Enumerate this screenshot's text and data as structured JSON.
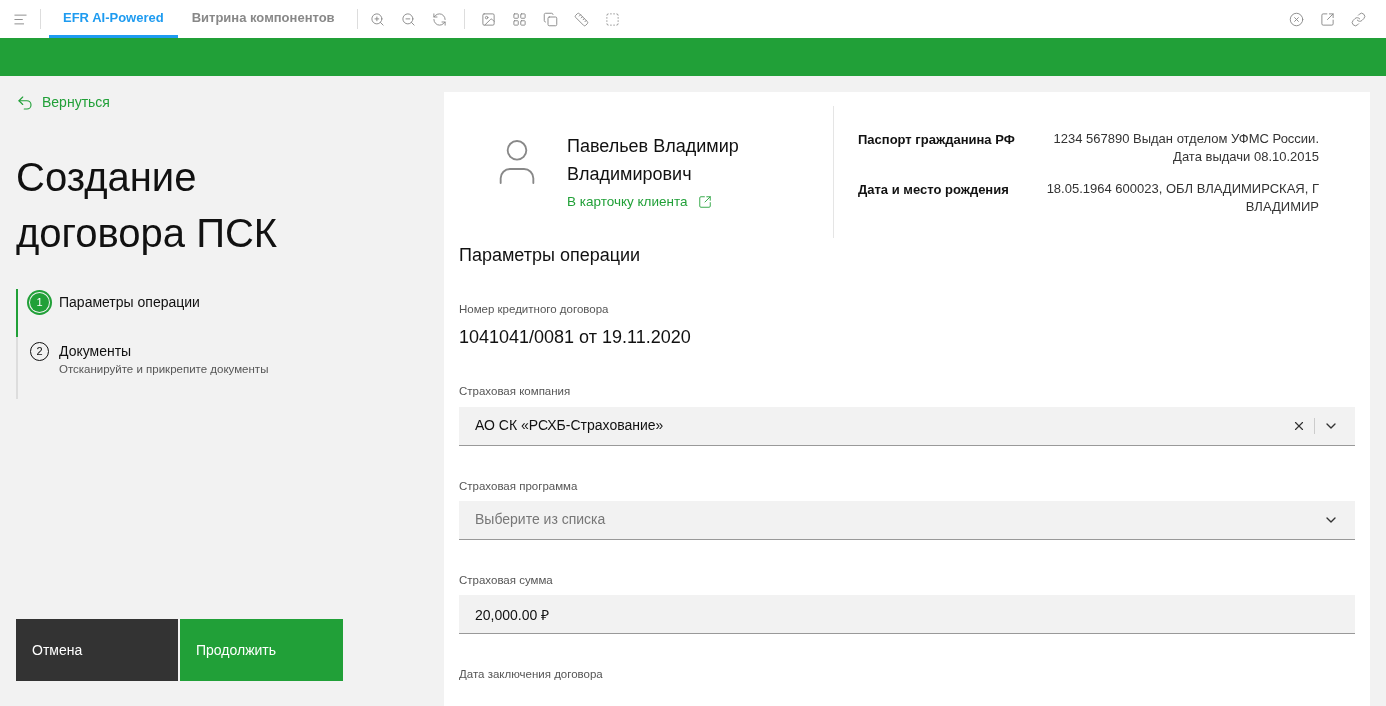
{
  "tabs": [
    {
      "label": "EFR AI-Powered",
      "selected": true
    },
    {
      "label": "Витрина компонентов",
      "selected": false
    }
  ],
  "back_link": "Вернуться",
  "title": "Создание договора ПСК",
  "steps": [
    {
      "number": "1",
      "label": "Параметры операции",
      "selected": true
    },
    {
      "number": "2",
      "label": "Документы",
      "hint": "Отсканируйте и прикрепите документы",
      "selected": false
    }
  ],
  "buttons": {
    "cancel": "Отмена",
    "continue": "Продолжить"
  },
  "client": {
    "name": "Павельев Владимир Владимирович",
    "card_link": "В карточку клиента",
    "details": [
      {
        "label": "Паспорт гражданина РФ",
        "value": "1234 567890 Выдан отделом УФМС России. Дата выдачи 08.10.2015"
      },
      {
        "label": "Дата и место рождения",
        "value": "18.05.1964 600023, ОБЛ ВЛАДИМИРСКАЯ, Г ВЛАДИМИР"
      }
    ]
  },
  "section_title": "Параметры операции",
  "fields": [
    {
      "kind": "static",
      "label": "Номер кредитного договора",
      "value": "1041041/0081 от 19.11.2020"
    },
    {
      "kind": "select",
      "label": "Страховая компания",
      "value": "АО СК «РСХБ-Страхование»",
      "clearable": true
    },
    {
      "kind": "select",
      "label": "Страховая программа",
      "placeholder": "Выберите из списка",
      "clearable": false
    },
    {
      "kind": "input",
      "label": "Страховая сумма",
      "value": "20,000.00 ₽"
    },
    {
      "kind": "heading",
      "label": "Дата заключения договора"
    }
  ]
}
